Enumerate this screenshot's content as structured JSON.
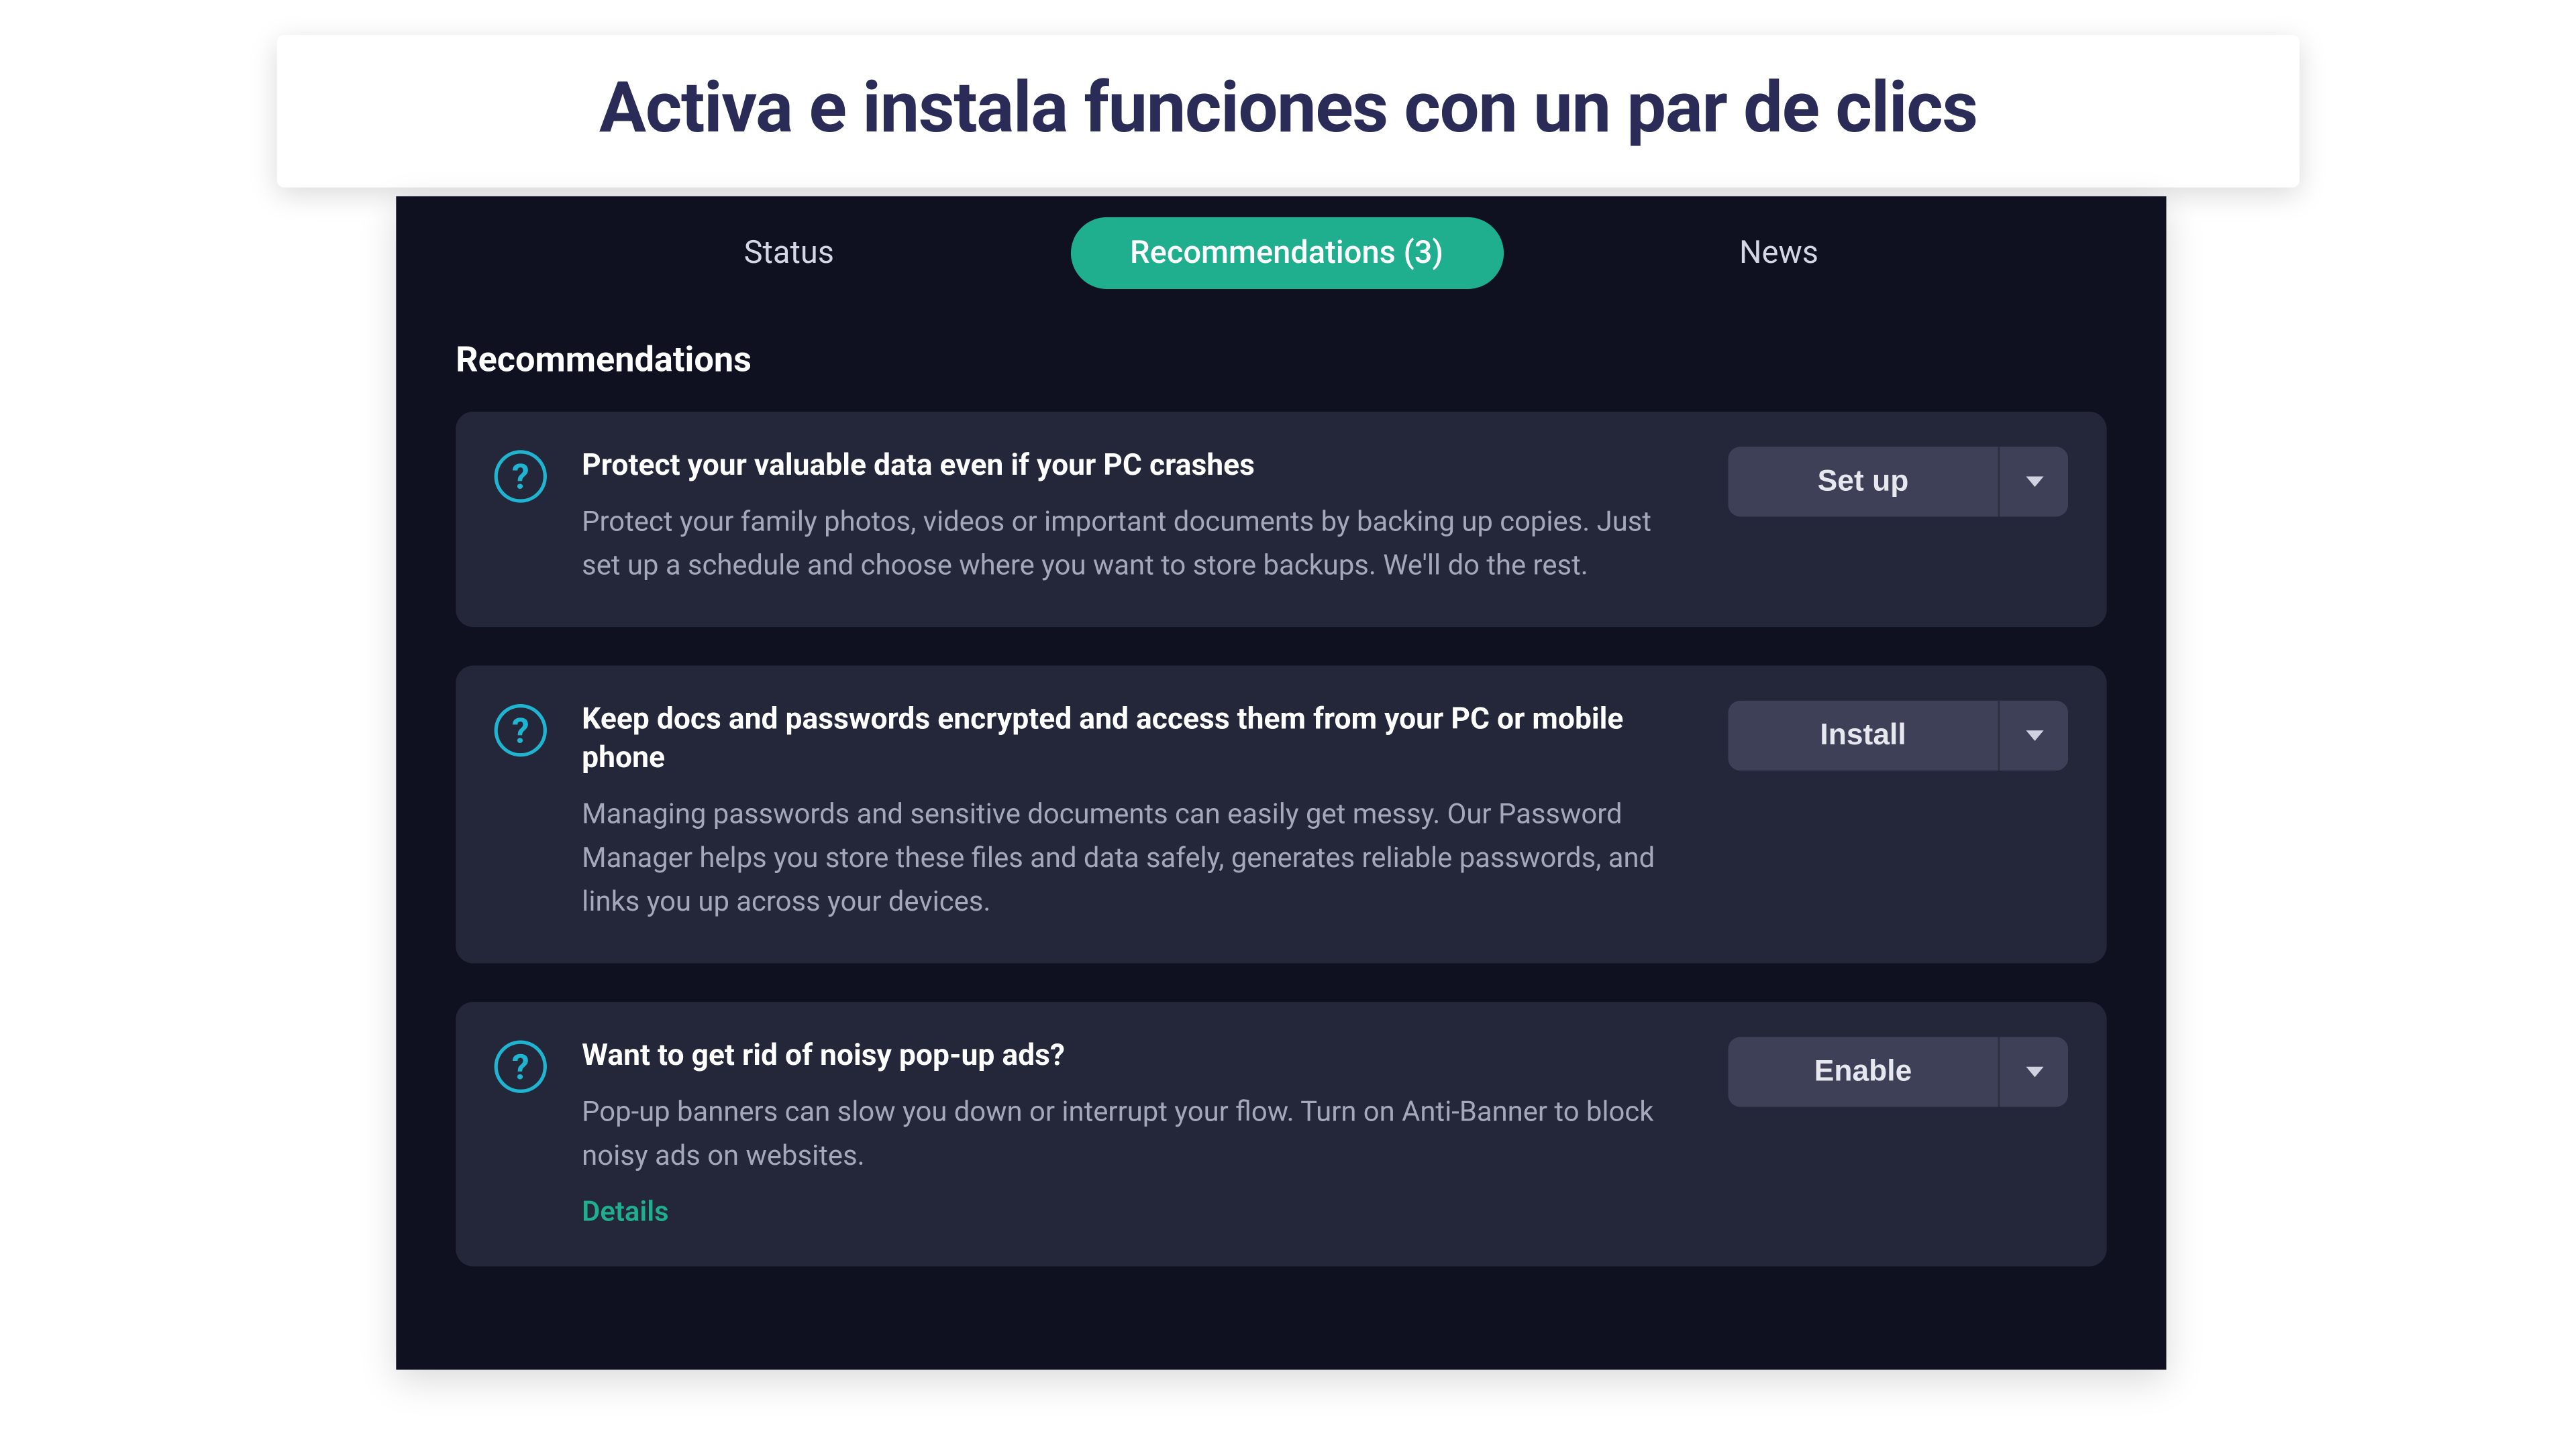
{
  "banner": {
    "title": "Activa e instala funciones con un par de clics"
  },
  "tabs": {
    "status": "Status",
    "recommendations": "Recommendations (3)",
    "news": "News"
  },
  "section": {
    "title": "Recommendations"
  },
  "cards": [
    {
      "title": "Protect your valuable data even if your PC crashes",
      "desc": "Protect your family photos, videos or important documents by backing up copies. Just set up a schedule and choose where you want to store backups. We'll do the rest.",
      "action": "Set up"
    },
    {
      "title": "Keep docs and passwords encrypted and access them from your PC or mobile phone",
      "desc": "Managing passwords and sensitive documents can easily get messy. Our Password Manager helps you store these files and data safely, generates reliable passwords, and links you up across your devices.",
      "action": "Install"
    },
    {
      "title": "Want to get rid of noisy pop-up ads?",
      "desc": "Pop-up banners can slow you down or interrupt your flow. Turn on Anti-Banner to block noisy ads on websites.",
      "details": "Details",
      "action": "Enable"
    }
  ]
}
